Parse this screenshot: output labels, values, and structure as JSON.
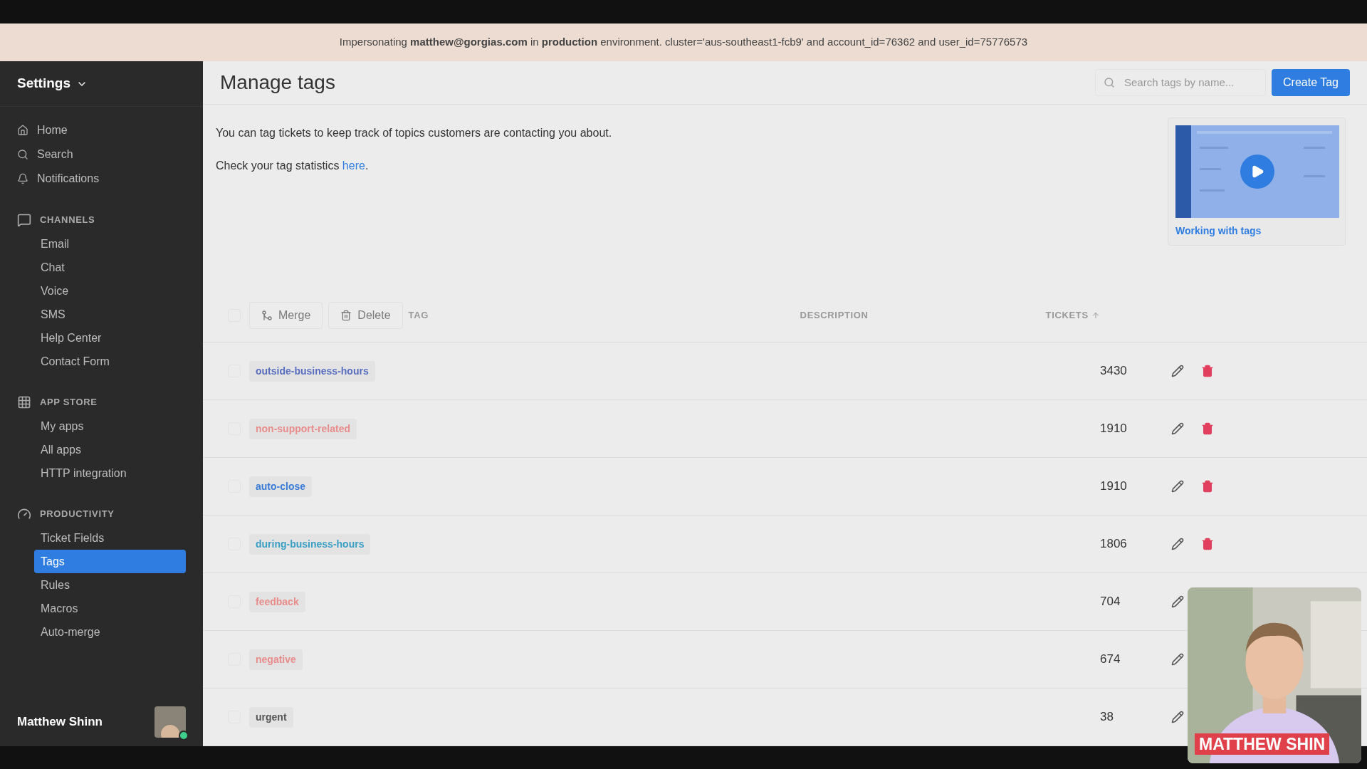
{
  "banner": {
    "text": "Impersonating **matthew@gorgias.com** in **production** environment. cluster='aus-southeast1-fcb9' and account_id=76362 and user_id=75776573"
  },
  "sidebar": {
    "title": "Settings",
    "top_items": [
      {
        "kind": "home",
        "label": "Home"
      },
      {
        "kind": "search",
        "label": "Search"
      },
      {
        "kind": "bell",
        "label": "Notifications"
      }
    ],
    "sections": [
      {
        "kind": "chat",
        "title": "CHANNELS",
        "items": [
          {
            "label": "Email",
            "selected": false
          },
          {
            "label": "Chat",
            "selected": false
          },
          {
            "label": "Voice",
            "selected": false
          },
          {
            "label": "SMS",
            "selected": false
          },
          {
            "label": "Help Center",
            "selected": false
          },
          {
            "label": "Contact Form",
            "selected": false
          }
        ]
      },
      {
        "kind": "grid",
        "title": "APP STORE",
        "items": [
          {
            "label": "My apps",
            "selected": false
          },
          {
            "label": "All apps",
            "selected": false
          },
          {
            "label": "HTTP integration",
            "selected": false
          }
        ]
      },
      {
        "kind": "gauge",
        "title": "PRODUCTIVITY",
        "items": [
          {
            "label": "Ticket Fields",
            "selected": false
          },
          {
            "label": "Tags",
            "selected": true
          },
          {
            "label": "Rules",
            "selected": false
          },
          {
            "label": "Macros",
            "selected": false
          },
          {
            "label": "Auto-merge",
            "selected": false
          }
        ]
      }
    ],
    "user": {
      "name": "Matthew Shinn",
      "online": true
    }
  },
  "header": {
    "title": "Manage tags",
    "search": {
      "placeholder": "Search tags by name..."
    },
    "create_button": "Create Tag"
  },
  "intro": [
    "You can tag tickets to keep track of topics customers are contacting you about.",
    "Check your tag statistics "
  ],
  "intro_link": "here",
  "intro_end": ".",
  "video": {
    "kind": "picture",
    "caption": "Working with tags"
  },
  "table": {
    "select_all_checked": false,
    "merge_button": {
      "label": "Merge",
      "disabled": true
    },
    "delete_button": {
      "label": "Delete",
      "disabled": true
    },
    "columns": [
      "TAG",
      "DESCRIPTION",
      "TICKETS"
    ],
    "rows": [
      {
        "tag": "outside-business-hours",
        "color": "#5a6ec0",
        "tickets": "3430",
        "checked": false,
        "delete_shown": true
      },
      {
        "tag": "non-support-related",
        "color": "#e88c8c",
        "tickets": "1910",
        "checked": false,
        "delete_shown": true
      },
      {
        "tag": "auto-close",
        "color": "#3a7bd5",
        "tickets": "1910",
        "checked": false,
        "delete_shown": true
      },
      {
        "tag": "during-business-hours",
        "color": "#3a9fc4",
        "tickets": "1806",
        "checked": false,
        "delete_shown": true
      },
      {
        "tag": "feedback",
        "color": "#e88c8c",
        "tickets": "704",
        "checked": false,
        "delete_shown": false
      },
      {
        "tag": "negative",
        "color": "#e88c8c",
        "tickets": "674",
        "checked": false,
        "delete_shown": false
      },
      {
        "tag": "urgent",
        "color": "#555555",
        "tickets": "38",
        "checked": false,
        "delete_shown": false
      }
    ]
  },
  "webcam": {
    "kind": "picture",
    "name_label": "MATTHEW SHIN"
  }
}
